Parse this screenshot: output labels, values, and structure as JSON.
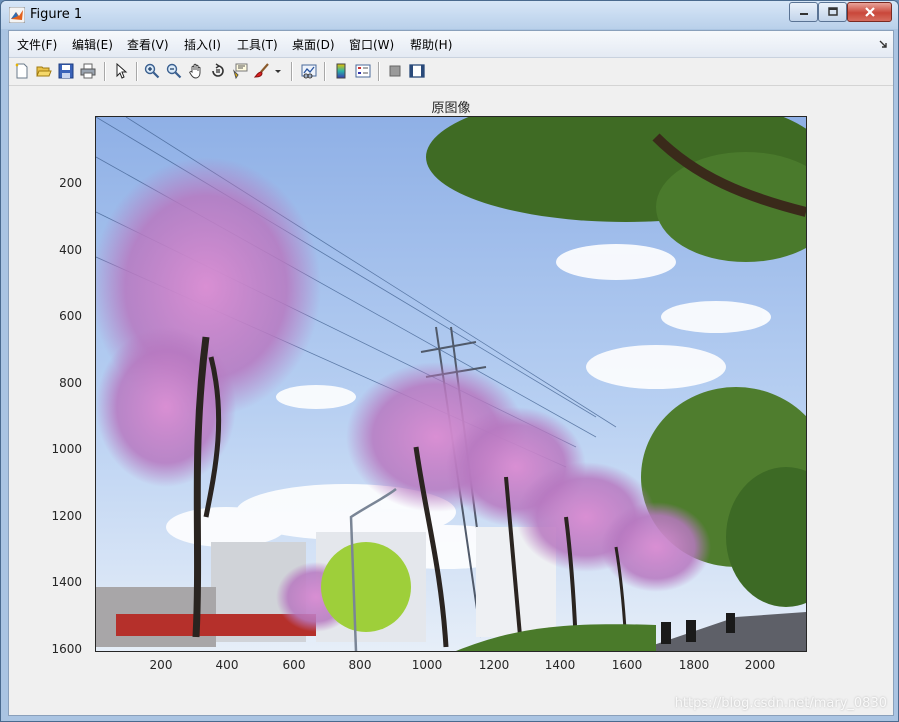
{
  "window": {
    "title": "Figure 1"
  },
  "menu": [
    {
      "label": "文件(F)"
    },
    {
      "label": "编辑(E)"
    },
    {
      "label": "查看(V)"
    },
    {
      "label": "插入(I)"
    },
    {
      "label": "工具(T)"
    },
    {
      "label": "桌面(D)"
    },
    {
      "label": "窗口(W)"
    },
    {
      "label": "帮助(H)"
    }
  ],
  "toolbar": [
    "new-figure-icon",
    "open-file-icon",
    "save-icon",
    "print-icon",
    "pointer-icon",
    "zoom-in-icon",
    "zoom-out-icon",
    "pan-hand-icon",
    "rotate-3d-icon",
    "data-cursor-icon",
    "brush-icon",
    "brush-dropdown-icon",
    "link-plot-icon",
    "colorbar-icon",
    "legend-icon",
    "hide-plot-tools-icon",
    "show-plot-tools-icon"
  ],
  "axes": {
    "title": "原图像",
    "xticks": [
      "200",
      "400",
      "600",
      "800",
      "1000",
      "1200",
      "1400",
      "1600",
      "1800",
      "2000"
    ],
    "yticks": [
      "200",
      "400",
      "600",
      "800",
      "1000",
      "1200",
      "1400",
      "1600"
    ]
  },
  "image": {
    "description_icon": "photo-icon"
  },
  "watermark": "https://blog.csdn.net/mary_0830",
  "colors": {
    "accent_close": "#c9473a",
    "sky": "#a9c6ea",
    "blossom": "#c77fc4",
    "foliage": "#4f7d2e"
  }
}
